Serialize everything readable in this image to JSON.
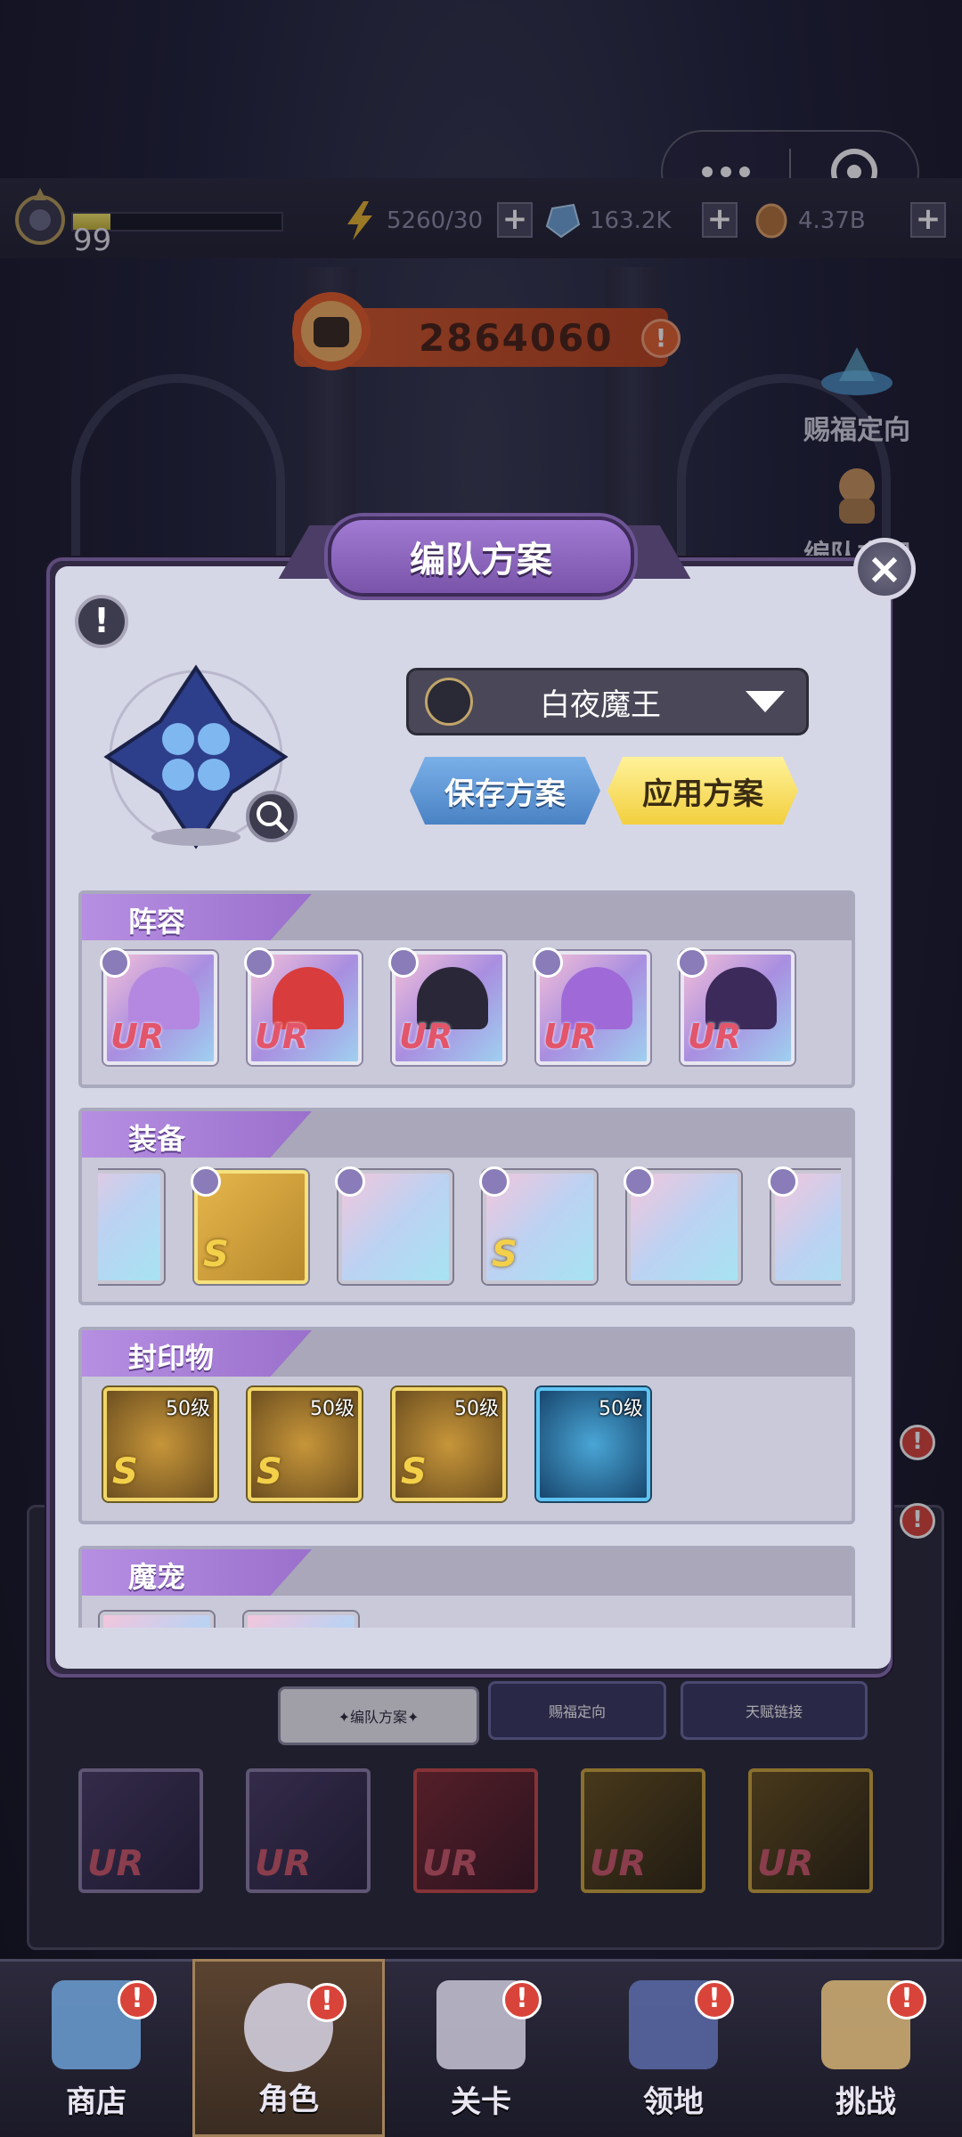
{
  "topbar": {
    "level": "99",
    "exp_fraction": 0.18,
    "stamina": "5260/30",
    "gems": "163.2K",
    "coins": "4.37B",
    "plus_label": "+"
  },
  "capsule": {
    "more_icon": "more-dots-icon",
    "close_icon": "target-close-icon"
  },
  "power": {
    "value": "2864060",
    "warn": "!"
  },
  "side_buttons": {
    "blessing": "赐福定向",
    "formation": "编队方案"
  },
  "modal": {
    "title": "编队方案",
    "close": "×",
    "info": "!",
    "plan_name": "白夜魔王",
    "save_label": "保存方案",
    "apply_label": "应用方案",
    "sections": {
      "lineup": "阵容",
      "equipment": "装备",
      "seals": "封印物",
      "pets": "魔宠"
    },
    "lineup_cards": [
      {
        "rarity": "UR",
        "hair": "#b488e0"
      },
      {
        "rarity": "UR",
        "hair": "#d93c3c"
      },
      {
        "rarity": "UR",
        "hair": "#2a2838"
      },
      {
        "rarity": "UR",
        "hair": "#9f6ad8"
      },
      {
        "rarity": "UR",
        "hair": "#3c2a5a"
      }
    ],
    "equipment_items": [
      {
        "grade": "",
        "gold": false
      },
      {
        "grade": "S",
        "gold": true
      },
      {
        "grade": "",
        "gold": false
      },
      {
        "grade": "S",
        "gold": false
      },
      {
        "grade": "",
        "gold": false
      },
      {
        "grade": "",
        "gold": false
      }
    ],
    "seal_items": [
      {
        "level": "50级",
        "grade": "S",
        "blue": false
      },
      {
        "level": "50级",
        "grade": "S",
        "blue": false
      },
      {
        "level": "50级",
        "grade": "S",
        "blue": false
      },
      {
        "level": "50级",
        "grade": "",
        "blue": true
      }
    ]
  },
  "behind_tabs": [
    "✦编队方案✦",
    "赐福定向",
    "天赋链接"
  ],
  "roster": [
    {
      "rarity": "UR",
      "style": ""
    },
    {
      "rarity": "UR",
      "style": ""
    },
    {
      "rarity": "UR",
      "style": "red"
    },
    {
      "rarity": "UR",
      "style": "gold"
    },
    {
      "rarity": "UR",
      "style": "gold"
    }
  ],
  "nav": [
    {
      "label": "商店",
      "badge": "!"
    },
    {
      "label": "角色",
      "badge": "!"
    },
    {
      "label": "关卡",
      "badge": "!"
    },
    {
      "label": "领地",
      "badge": "!"
    },
    {
      "label": "挑战",
      "badge": "!"
    }
  ],
  "colors": {
    "accent_purple": "#9a70cc",
    "apply_yellow": "#f2cf3e",
    "save_blue": "#4a82c4",
    "power_orange": "#d75a2c"
  }
}
